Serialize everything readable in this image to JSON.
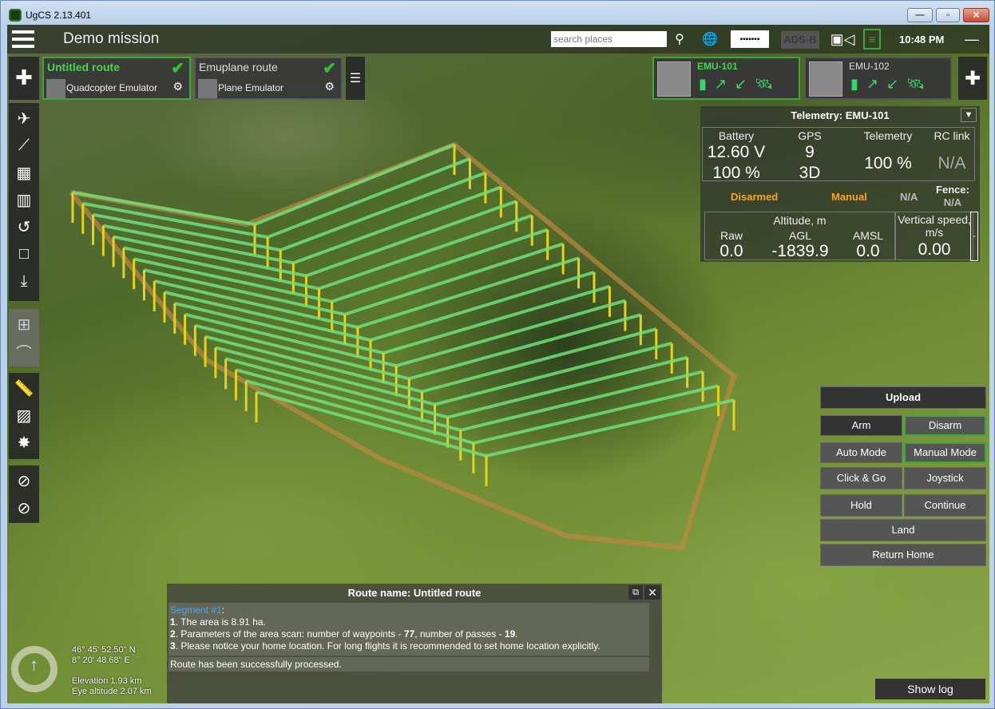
{
  "window": {
    "title": "UgCS 2.13.401",
    "controls": [
      "minimize",
      "maximize",
      "close"
    ]
  },
  "header": {
    "mission_title": "Demo mission",
    "search_placeholder": "search places",
    "adsb_label": "ADS-B",
    "clock": "10:48 PM"
  },
  "routes": [
    {
      "name": "Untitled route",
      "vehicle": "Quadcopter Emulator",
      "active": true
    },
    {
      "name": "Emuplane route",
      "vehicle": "Plane Emulator",
      "active": false
    }
  ],
  "vehicles": [
    {
      "name": "EMU-101",
      "active": true
    },
    {
      "name": "EMU-102",
      "active": false
    }
  ],
  "telemetry": {
    "title": "Telemetry: EMU-101",
    "battery_label": "Battery",
    "battery_voltage": "12.60 V",
    "battery_percent": "100 %",
    "gps_label": "GPS",
    "gps_sats": "9",
    "gps_fix": "3D",
    "telemetry_label": "Telemetry",
    "telemetry_value": "100 %",
    "rc_label": "RC link",
    "rc_value": "N/A",
    "arm_state": "Disarmed",
    "mode": "Manual",
    "status_na": "N/A",
    "fence_label": "Fence:",
    "fence_value": "N/A",
    "altitude_label": "Altitude, m",
    "raw_label": "Raw",
    "raw_value": "0.0",
    "agl_label": "AGL",
    "agl_value": "-1839.9",
    "amsl_label": "AMSL",
    "amsl_value": "0.0",
    "vspeed_label": "Vertical speed,",
    "vspeed_unit": "m/s",
    "vspeed_value": "0.00",
    "scale_mark": "-"
  },
  "commands": {
    "upload": "Upload",
    "arm": "Arm",
    "disarm": "Disarm",
    "auto": "Auto Mode",
    "manual": "Manual Mode",
    "clickgo": "Click & Go",
    "joystick": "Joystick",
    "hold": "Hold",
    "continue": "Continue",
    "land": "Land",
    "rth": "Return Home"
  },
  "message": {
    "title": "Route name: Untitled route",
    "segment": "Segment #1",
    "line1_num": "1",
    "line1": ". The area is 8.91 ha.",
    "line2_num": "2",
    "line2_a": ". Parameters of the area scan: number of waypoints - ",
    "line2_wp": "77",
    "line2_b": ", number of passes - ",
    "line2_passes": "19",
    "line2_c": ".",
    "line3_num": "3",
    "line3": ". Please notice your home location. For long flights it is recommended to set home location explicitly.",
    "status": "Route has been successfully processed."
  },
  "map_info": {
    "lat": "46° 45' 52.50\" N",
    "lon": "8° 20' 48.68\" E",
    "elevation": "Elevation 1.93 km",
    "eye_altitude": "Eye altitude 2.07 km"
  },
  "show_log": "Show log",
  "colors": {
    "accent": "#3aa83a",
    "active_text": "#4ad44a",
    "warning": "#f5a623",
    "link": "#4aa8f0"
  }
}
